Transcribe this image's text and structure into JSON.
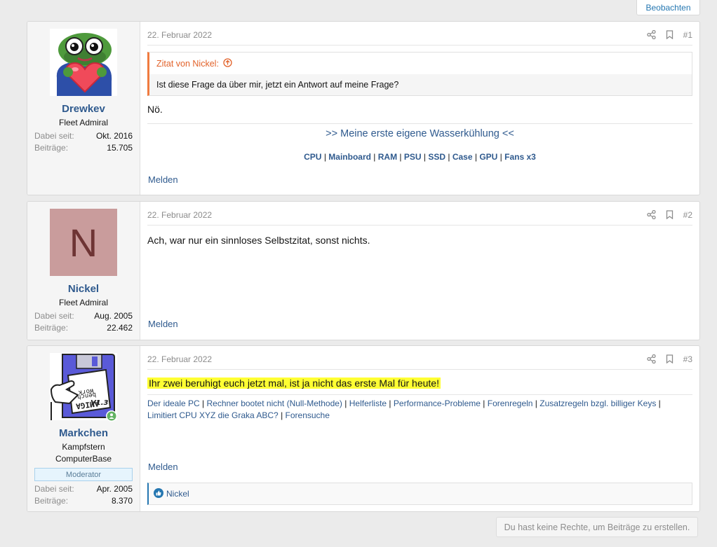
{
  "thread": {
    "watch_label": "Beobachten",
    "no_rights_label": "Du hast keine Rechte, um Beiträge zu erstellen."
  },
  "posts": [
    {
      "user": {
        "name": "Drewkev",
        "title": "Fleet Admiral",
        "joined_label": "Dabei seit:",
        "joined": "Okt. 2016",
        "posts_label": "Beiträge:",
        "posts": "15.705"
      },
      "date": "22. Februar 2022",
      "number": "#1",
      "quote": {
        "author": "Zitat von Nickel:",
        "text": "Ist diese Frage da über mir, jetzt ein Antwort auf meine Frage?"
      },
      "body": "Nö.",
      "signature": {
        "headline": ">> Meine erste eigene Wasserkühlung <<",
        "links": [
          "CPU",
          "Mainboard",
          "RAM",
          "PSU",
          "SSD",
          "Case",
          "GPU",
          "Fans x3"
        ]
      },
      "report_label": "Melden"
    },
    {
      "user": {
        "name": "Nickel",
        "initial": "N",
        "title": "Fleet Admiral",
        "joined_label": "Dabei seit:",
        "joined": "Aug. 2005",
        "posts_label": "Beiträge:",
        "posts": "22.462"
      },
      "date": "22. Februar 2022",
      "number": "#2",
      "body": "Ach, war nur ein sinnloses Selbstzitat, sonst nichts.",
      "report_label": "Melden"
    },
    {
      "user": {
        "name": "Markchen",
        "title_line1": "Kampfstern",
        "title_line2": "ComputerBase",
        "badge": "Moderator",
        "joined_label": "Dabei seit:",
        "joined": "Apr. 2005",
        "posts_label": "Beiträge:",
        "posts": "8.370"
      },
      "date": "22. Februar 2022",
      "number": "#3",
      "body": "Ihr zwei beruhigt euch jetzt mal, ist ja nicht das erste Mal für heute!",
      "signature": {
        "links": [
          "Der ideale PC",
          "Rechner bootet nicht (Null-Methode)",
          "Helferliste",
          "Performance-Probleme",
          "Forenregeln",
          "Zusatzregeln bzgl. billiger Keys",
          "Limitiert CPU XYZ die Graka ABC?",
          "Forensuche"
        ]
      },
      "report_label": "Melden",
      "reaction_user": "Nickel"
    }
  ],
  "colors": {
    "link": "#2f5a8e",
    "quote_accent": "#f07b3f",
    "highlight": "#ffff33",
    "nickel_avatar_bg": "#c99c9c",
    "nickel_avatar_fg": "#6e3434"
  }
}
